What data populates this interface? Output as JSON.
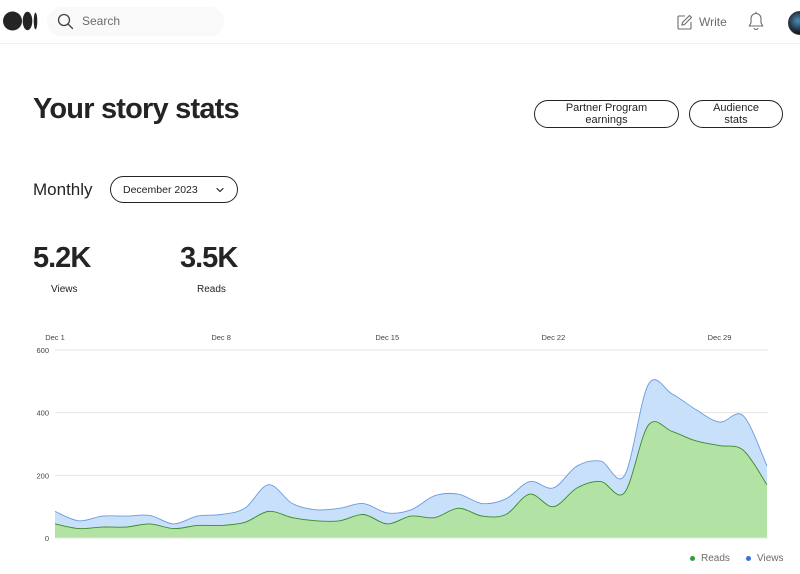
{
  "header": {
    "search_placeholder": "Search",
    "write_label": "Write",
    "icons": [
      "medium-logo-icon",
      "search-icon",
      "write-icon",
      "bell-icon",
      "avatar"
    ]
  },
  "page": {
    "title": "Your story stats",
    "partner_button": "Partner Program earnings",
    "audience_button": "Audience stats",
    "period_label": "Monthly",
    "month_selected": "December 2023"
  },
  "stats": {
    "views": {
      "value": "5.2K",
      "label": "Views"
    },
    "reads": {
      "value": "3.5K",
      "label": "Reads"
    }
  },
  "colors": {
    "views_fill": "#c9e0fb",
    "views_line": "#6b9be0",
    "reads_fill": "#b3e3a4",
    "reads_line": "#3b8a2a",
    "legend_reads": "#2e9e3a",
    "legend_views": "#3b6fdb"
  },
  "chart_data": {
    "type": "area",
    "x": [
      1,
      2,
      3,
      4,
      5,
      6,
      7,
      8,
      9,
      10,
      11,
      12,
      13,
      14,
      15,
      16,
      17,
      18,
      19,
      20,
      21,
      22,
      23,
      24,
      25,
      26,
      27,
      28,
      29,
      30,
      31
    ],
    "x_tick_labels": [
      {
        "day": 1,
        "label": "Dec 1"
      },
      {
        "day": 8,
        "label": "Dec 8"
      },
      {
        "day": 15,
        "label": "Dec 15"
      },
      {
        "day": 22,
        "label": "Dec 22"
      },
      {
        "day": 29,
        "label": "Dec 29"
      }
    ],
    "y_ticks": [
      0,
      200,
      400,
      600
    ],
    "ylim": [
      0,
      600
    ],
    "grid": true,
    "legend_position": "bottom-right",
    "series": [
      {
        "name": "Views",
        "values": [
          85,
          55,
          70,
          70,
          72,
          45,
          70,
          75,
          95,
          170,
          110,
          90,
          95,
          110,
          80,
          90,
          135,
          140,
          110,
          125,
          180,
          160,
          230,
          245,
          200,
          490,
          460,
          410,
          370,
          390,
          230
        ]
      },
      {
        "name": "Reads",
        "values": [
          45,
          30,
          35,
          35,
          45,
          30,
          40,
          40,
          50,
          85,
          65,
          55,
          55,
          75,
          45,
          70,
          65,
          95,
          70,
          75,
          140,
          100,
          160,
          180,
          145,
          360,
          340,
          310,
          295,
          280,
          170
        ]
      }
    ]
  }
}
